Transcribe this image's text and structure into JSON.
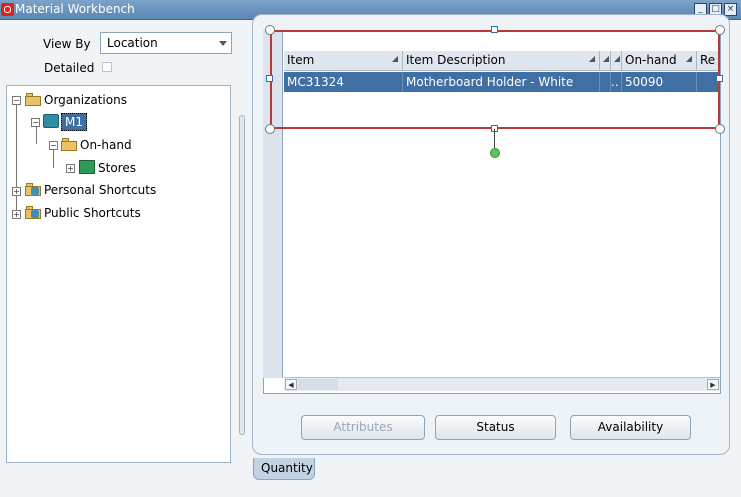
{
  "window": {
    "title": "Material Workbench",
    "controls": [
      "minimize-icon",
      "maximize-icon",
      "close-icon"
    ]
  },
  "view_by": {
    "label": "View By",
    "selected": "Location"
  },
  "detailed": {
    "label": "Detailed",
    "checked": false
  },
  "tree": {
    "nodes": [
      {
        "label": "Organizations",
        "icon": "folder-org-icon",
        "expanded": true
      },
      {
        "label": "M1",
        "icon": "organization-icon",
        "expanded": true,
        "selected": true
      },
      {
        "label": "On-hand",
        "icon": "folder-onhand-icon",
        "expanded": true
      },
      {
        "label": "Stores",
        "icon": "subinventory-icon",
        "expanded": false
      },
      {
        "label": "Personal Shortcuts",
        "icon": "folder-shortcut-icon",
        "expanded": false
      },
      {
        "label": "Public Shortcuts",
        "icon": "folder-public-icon",
        "expanded": false
      }
    ]
  },
  "table": {
    "columns": [
      "Item",
      "Item Description",
      "",
      "",
      "On-hand",
      "Re"
    ],
    "rows": [
      {
        "item": "MC31324",
        "description": "Motherboard Holder - White",
        "c3": "",
        "c4": "..",
        "onhand": "50090",
        "re": ""
      }
    ]
  },
  "buttons": {
    "attributes": "Attributes",
    "status": "Status",
    "availability": "Availability"
  },
  "tabs": {
    "quantity": "Quantity"
  },
  "colors": {
    "titlebar": "#5a87b4",
    "selection": "#3f6fa3",
    "highlight_border": "#b53a3a"
  }
}
